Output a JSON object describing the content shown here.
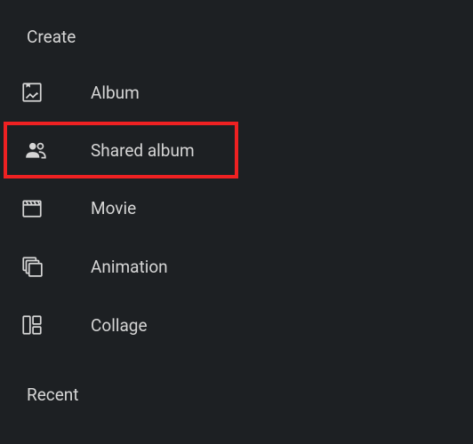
{
  "sections": {
    "create": {
      "header": "Create",
      "items": [
        {
          "label": "Album"
        },
        {
          "label": "Shared album"
        },
        {
          "label": "Movie"
        },
        {
          "label": "Animation"
        },
        {
          "label": "Collage"
        }
      ]
    },
    "recent": {
      "header": "Recent"
    }
  }
}
